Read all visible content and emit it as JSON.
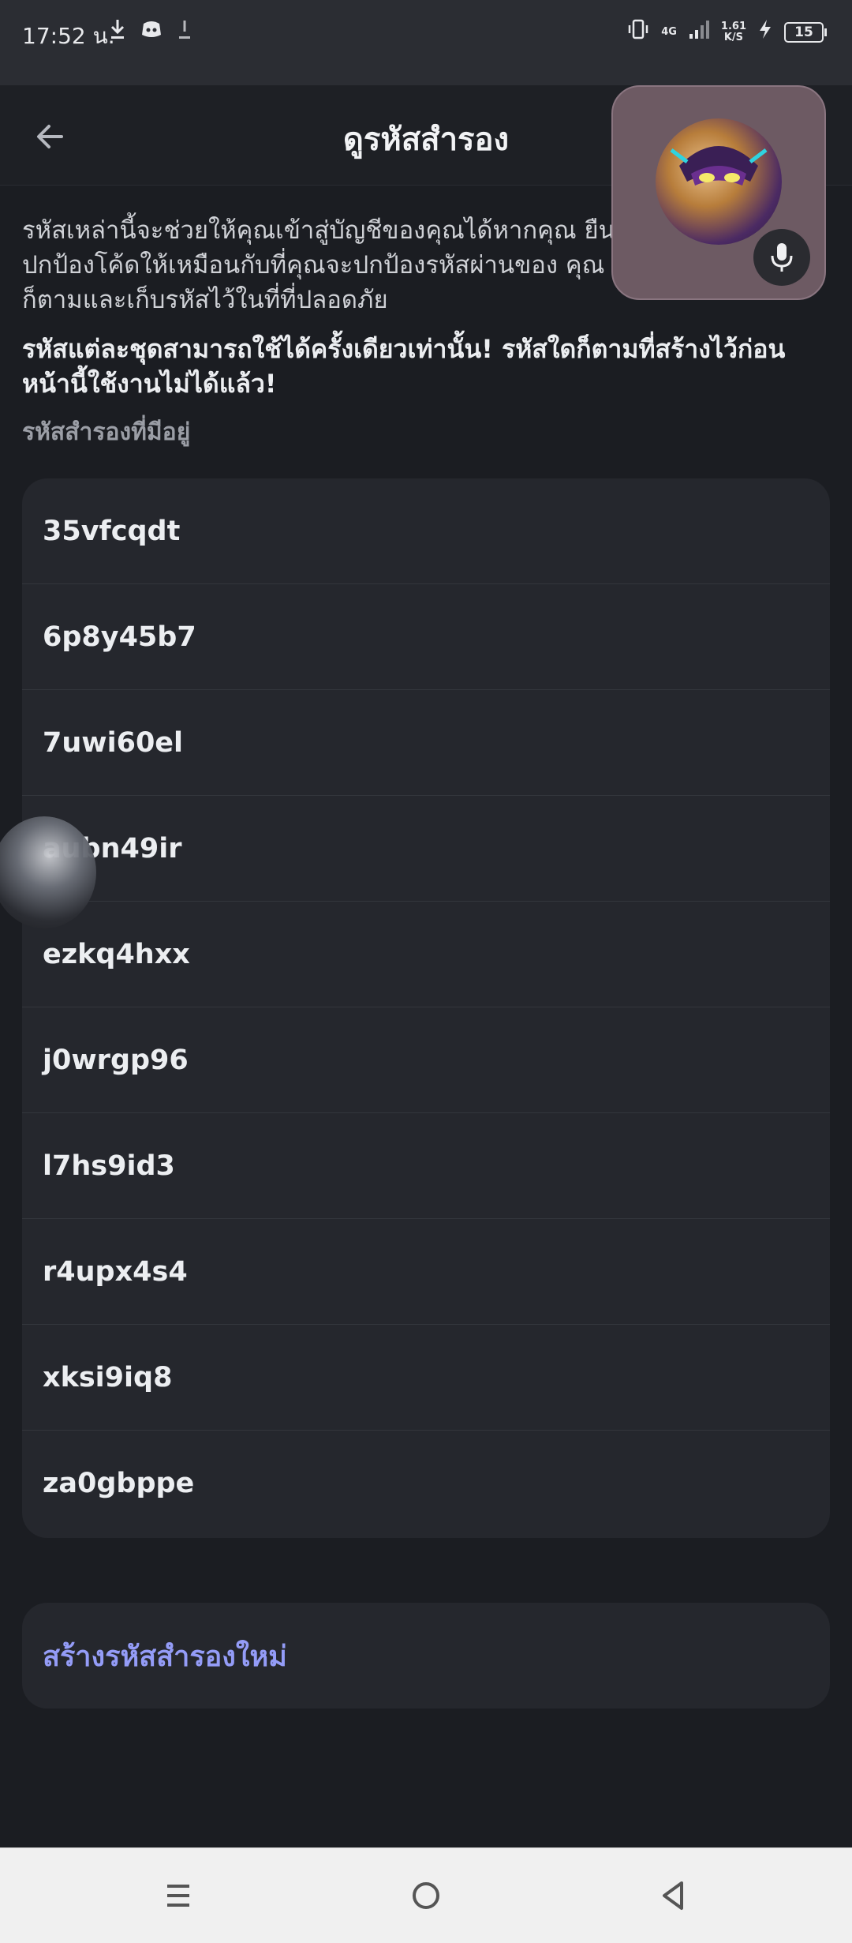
{
  "status_bar": {
    "time": "17:52 น.",
    "network": "4G",
    "speed_value": "1.61",
    "speed_unit": "K/S",
    "battery": "15"
  },
  "header": {
    "title": "ดูรหัสสำรอง"
  },
  "content": {
    "description": "รหัสเหล่านี้จะช่วยให้คุณเข้าสู่บัญชีของคุณได้หากคุณ ยืนยันตัวตน ฉะนั้นให้ปกป้องโค้ดให้เหมือนกับที่คุณจะปกป้องรหัสผ่านของ คุณ อย่าแชร์รหัสกับใครก็ตามและเก็บรหัสไว้ในที่ที่ปลอดภัย",
    "warning": "รหัสแต่ละชุดสามารถใช้ได้ครั้งเดียวเท่านั้น! รหัสใดก็ตามที่สร้างไว้ก่อนหน้านี้ใช้งานไม่ได้แล้ว!",
    "section_label": "รหัสสำรองที่มีอยู่",
    "codes": [
      "35vfcqdt",
      "6p8y45b7",
      "7uwi60el",
      "aubn49ir",
      "ezkq4hxx",
      "j0wrgp96",
      "l7hs9id3",
      "r4upx4s4",
      "xksi9iq8",
      "za0gbppe"
    ],
    "regenerate_label": "สร้างรหัสสำรองใหม่"
  },
  "colors": {
    "background": "#1b1d22",
    "card": "#25272d",
    "accent": "#949cf7"
  },
  "icons": {
    "back": "arrow-left-icon",
    "mic": "microphone-icon",
    "nav_menu": "menu-icon",
    "nav_home": "home-circle-icon",
    "nav_back": "triangle-back-icon"
  }
}
